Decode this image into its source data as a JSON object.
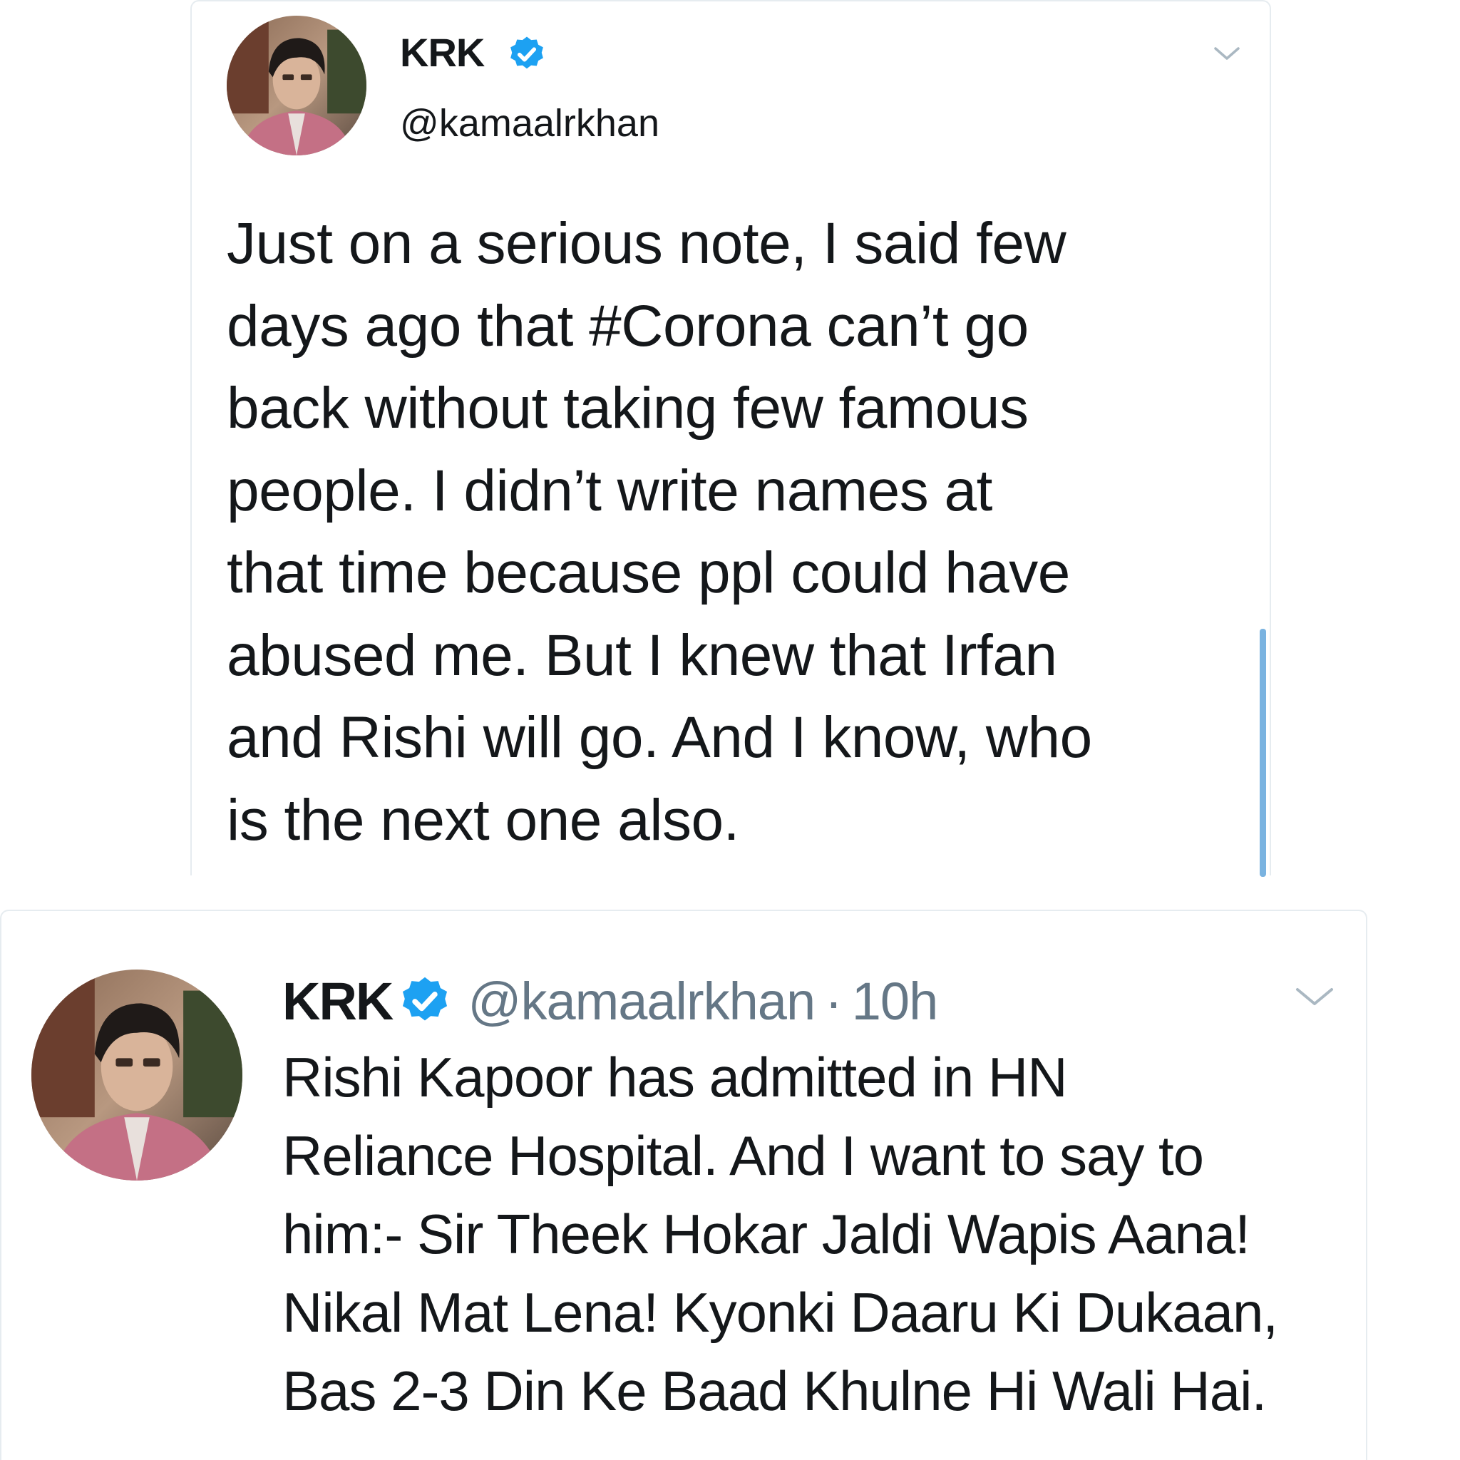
{
  "tweets": [
    {
      "display_name": "KRK",
      "handle": "@kamaalrkhan",
      "verified": true,
      "icons": {
        "verified": "verified-badge-icon",
        "menu": "chevron-down-icon"
      },
      "text": "Just on a serious note, I said few\ndays ago that #Corona can’t go\nback without taking few famous\npeople. I didn’t write names at\nthat time because ppl could have\nabused me. But I knew that Irfan\nand Rishi will go. And I know, who\nis the next one also."
    },
    {
      "display_name": "KRK",
      "handle": "@kamaalrkhan",
      "separator": "·",
      "time": "10h",
      "verified": true,
      "icons": {
        "verified": "verified-badge-icon",
        "menu": "chevron-down-icon"
      },
      "text": "Rishi Kapoor has admitted in HN\nReliance Hospital. And I want to say to\nhim:- Sir Theek Hokar Jaldi Wapis Aana!\nNikal Mat Lena! Kyonki Daaru Ki Dukaan,\nBas 2-3 Din Ke Baad Khulne Hi Wali Hai."
    }
  ],
  "colors": {
    "text_primary": "#14171a",
    "text_secondary": "#657786",
    "verified_blue": "#1da1f2",
    "border": "#e6ecf0",
    "scrollbar": "#7ab3e0"
  }
}
